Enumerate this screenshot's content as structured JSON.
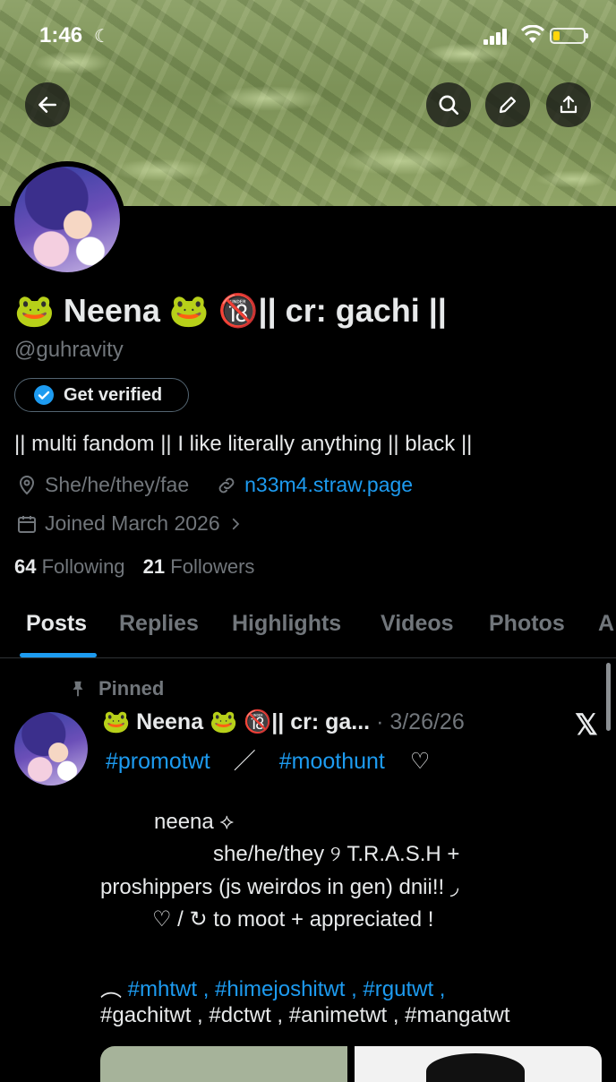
{
  "status_bar": {
    "time": "1:46",
    "battery_percent": 20
  },
  "profile": {
    "name": "🐸 Neena 🐸 🔞|| cr: gachi ||",
    "handle": "@guhravity",
    "get_verified_label": "Get verified",
    "bio": "|| multi fandom || I like literally anything || black ||",
    "pronouns": "She/he/they/fae",
    "website": "n33m4.straw.page",
    "joined": "Joined March 2026",
    "following_count": "64",
    "following_label": "Following",
    "followers_count": "21",
    "followers_label": "Followers"
  },
  "tabs": [
    {
      "label": "Posts"
    },
    {
      "label": "Replies"
    },
    {
      "label": "Highlights"
    },
    {
      "label": "Videos"
    },
    {
      "label": "Photos"
    },
    {
      "label": "A"
    }
  ],
  "pinned_post": {
    "pinned_label": "Pinned",
    "author": "🐸 Neena 🐸 🔞|| cr: ga...",
    "date": "· 3/26/26",
    "tag_promotwt": "#promotwt",
    "separator": "／",
    "tag_moothunt": "#moothunt",
    "heart": "♡",
    "line1": "neena   ⟡",
    "line2": "she/he/they    ୨    T.R.A.S.H +",
    "line3": "proshippers (js weirdos in gen) dnii!!    ◞",
    "line4": "♡  /  ↻  to  moot  +  appreciated  !",
    "line5_prefix": "︵",
    "line5_tags": "#mhtwt , #himejoshitwt , #rgutwt ,",
    "line6_tags": "#gachitwt , #dctwt , #animetwt , #mangatwt"
  },
  "icons": {
    "back": "back-arrow-icon",
    "search": "search-icon",
    "edit": "pencil-icon",
    "share": "share-icon",
    "verified": "verified-badge-icon",
    "location": "location-pin-icon",
    "link": "link-icon",
    "calendar": "calendar-icon",
    "pin": "pin-icon",
    "platform": "x-logo-icon"
  },
  "colors": {
    "accent": "#1d9bf0",
    "muted": "#71767b",
    "text": "#e7e9ea",
    "background": "#000000"
  }
}
